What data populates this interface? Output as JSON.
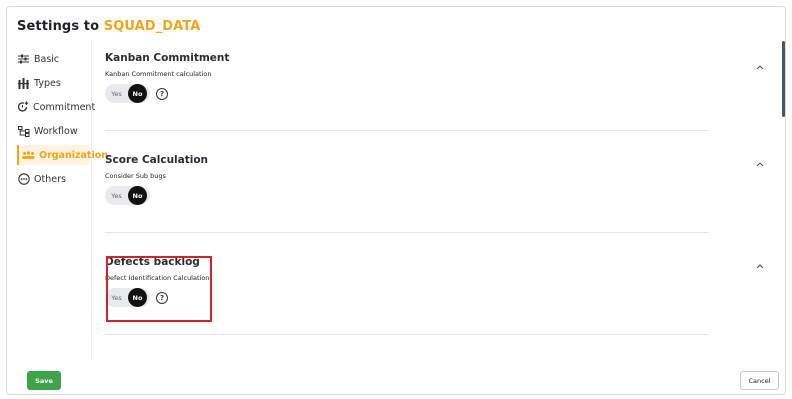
{
  "header": {
    "title_prefix": "Settings to ",
    "project_name": "SQUAD_DATA"
  },
  "sidebar": {
    "items": [
      {
        "label": "Basic",
        "icon": "sliders-icon",
        "active": false
      },
      {
        "label": "Types",
        "icon": "types-icon",
        "active": false
      },
      {
        "label": "Commitment",
        "icon": "commitment-icon",
        "active": false
      },
      {
        "label": "Workflow",
        "icon": "workflow-icon",
        "active": false
      },
      {
        "label": "Organization",
        "icon": "organization-icon",
        "active": true
      },
      {
        "label": "Others",
        "icon": "more-icon",
        "active": false
      }
    ]
  },
  "sections": [
    {
      "title": "Kanban Commitment",
      "subtitle": "Kanban Commitment calculation",
      "yes": "Yes",
      "no": "No",
      "help": "?"
    },
    {
      "title": "Score Calculation",
      "subtitle": "Consider Sub bugs",
      "yes": "Yes",
      "no": "No"
    },
    {
      "title": "Defects backlog",
      "subtitle": "Defect Identification Calculation",
      "yes": "Yes",
      "no": "No",
      "help": "?"
    }
  ],
  "footer": {
    "save": "Save",
    "cancel": "Cancel"
  },
  "colors": {
    "accent": "#f4a31a",
    "save": "#3fa34a",
    "highlight": "#d62127"
  }
}
